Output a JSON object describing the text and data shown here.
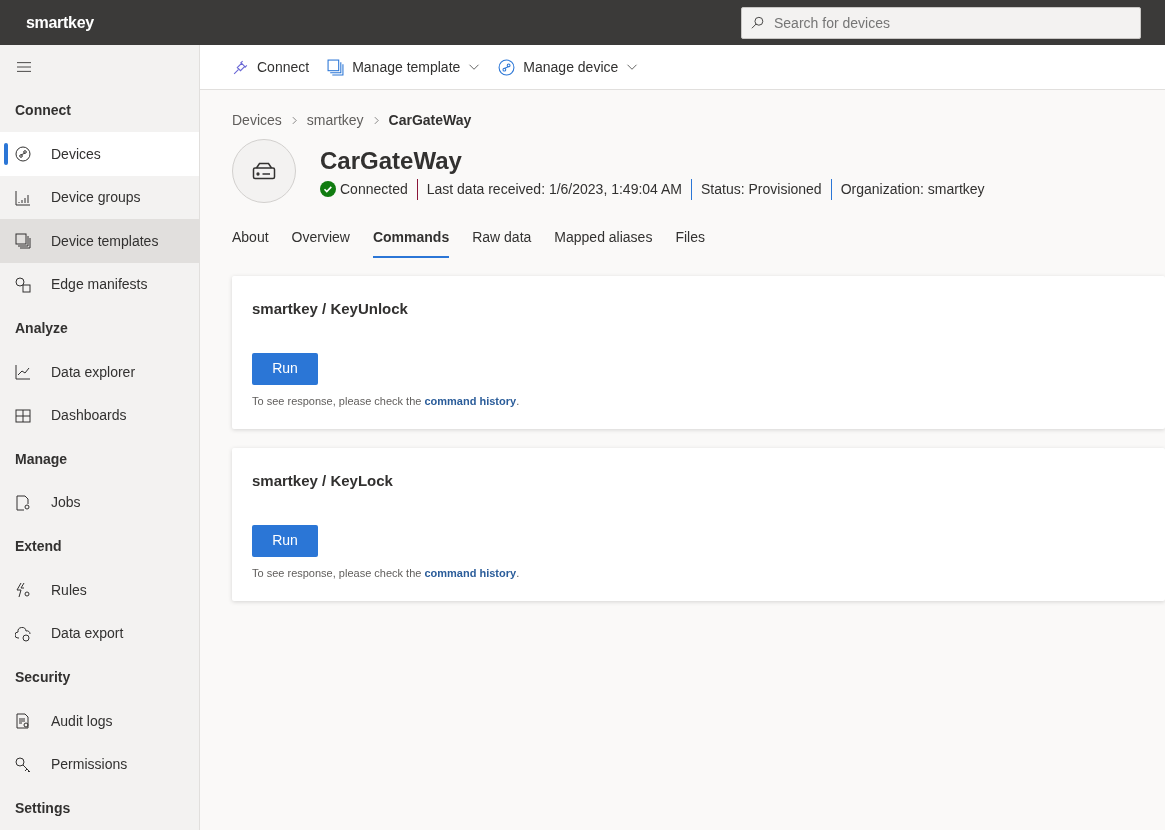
{
  "header": {
    "brand": "smartkey",
    "search": {
      "placeholder": "Search for devices"
    }
  },
  "sidebar": {
    "items": [
      {
        "kind": "section",
        "label": "Connect"
      },
      {
        "kind": "link",
        "label": "Devices",
        "selected": true,
        "hovered": false
      },
      {
        "kind": "link",
        "label": "Device groups",
        "selected": false,
        "hovered": false
      },
      {
        "kind": "link",
        "label": "Device templates",
        "selected": false,
        "hovered": true
      },
      {
        "kind": "link",
        "label": "Edge manifests",
        "selected": false,
        "hovered": false
      },
      {
        "kind": "section",
        "label": "Analyze"
      },
      {
        "kind": "link",
        "label": "Data explorer",
        "selected": false,
        "hovered": false
      },
      {
        "kind": "link",
        "label": "Dashboards",
        "selected": false,
        "hovered": false
      },
      {
        "kind": "section",
        "label": "Manage"
      },
      {
        "kind": "link",
        "label": "Jobs",
        "selected": false,
        "hovered": false
      },
      {
        "kind": "section",
        "label": "Extend"
      },
      {
        "kind": "link",
        "label": "Rules",
        "selected": false,
        "hovered": false
      },
      {
        "kind": "link",
        "label": "Data export",
        "selected": false,
        "hovered": false
      },
      {
        "kind": "section",
        "label": "Security"
      },
      {
        "kind": "link",
        "label": "Audit logs",
        "selected": false,
        "hovered": false
      },
      {
        "kind": "link",
        "label": "Permissions",
        "selected": false,
        "hovered": false
      },
      {
        "kind": "section",
        "label": "Settings"
      }
    ]
  },
  "toolbar": [
    {
      "label": "Connect",
      "dropdown": false
    },
    {
      "label": "Manage template",
      "dropdown": true
    },
    {
      "label": "Manage device",
      "dropdown": true
    }
  ],
  "breadcrumb": [
    {
      "label": "Devices",
      "current": false
    },
    {
      "label": "smartkey",
      "current": false
    },
    {
      "label": "CarGateWay",
      "current": true
    }
  ],
  "device": {
    "name": "CarGateWay",
    "connection": "Connected",
    "connected": true,
    "details": [
      "Last data received: 1/6/2023, 1:49:04 AM",
      "Status: Provisioned",
      "Organization: smartkey"
    ]
  },
  "tabs": [
    {
      "label": "About",
      "selected": false
    },
    {
      "label": "Overview",
      "selected": false
    },
    {
      "label": "Commands",
      "selected": true
    },
    {
      "label": "Raw data",
      "selected": false
    },
    {
      "label": "Mapped aliases",
      "selected": false
    },
    {
      "label": "Files",
      "selected": false
    }
  ],
  "commands": [
    {
      "title": "smartkey / KeyUnlock",
      "button": "Run",
      "note": "To see response, please check the ",
      "link": "command history",
      "end": "."
    },
    {
      "title": "smartkey / KeyLock",
      "button": "Run",
      "note": "To see response, please check the ",
      "link": "command history",
      "end": "."
    }
  ]
}
